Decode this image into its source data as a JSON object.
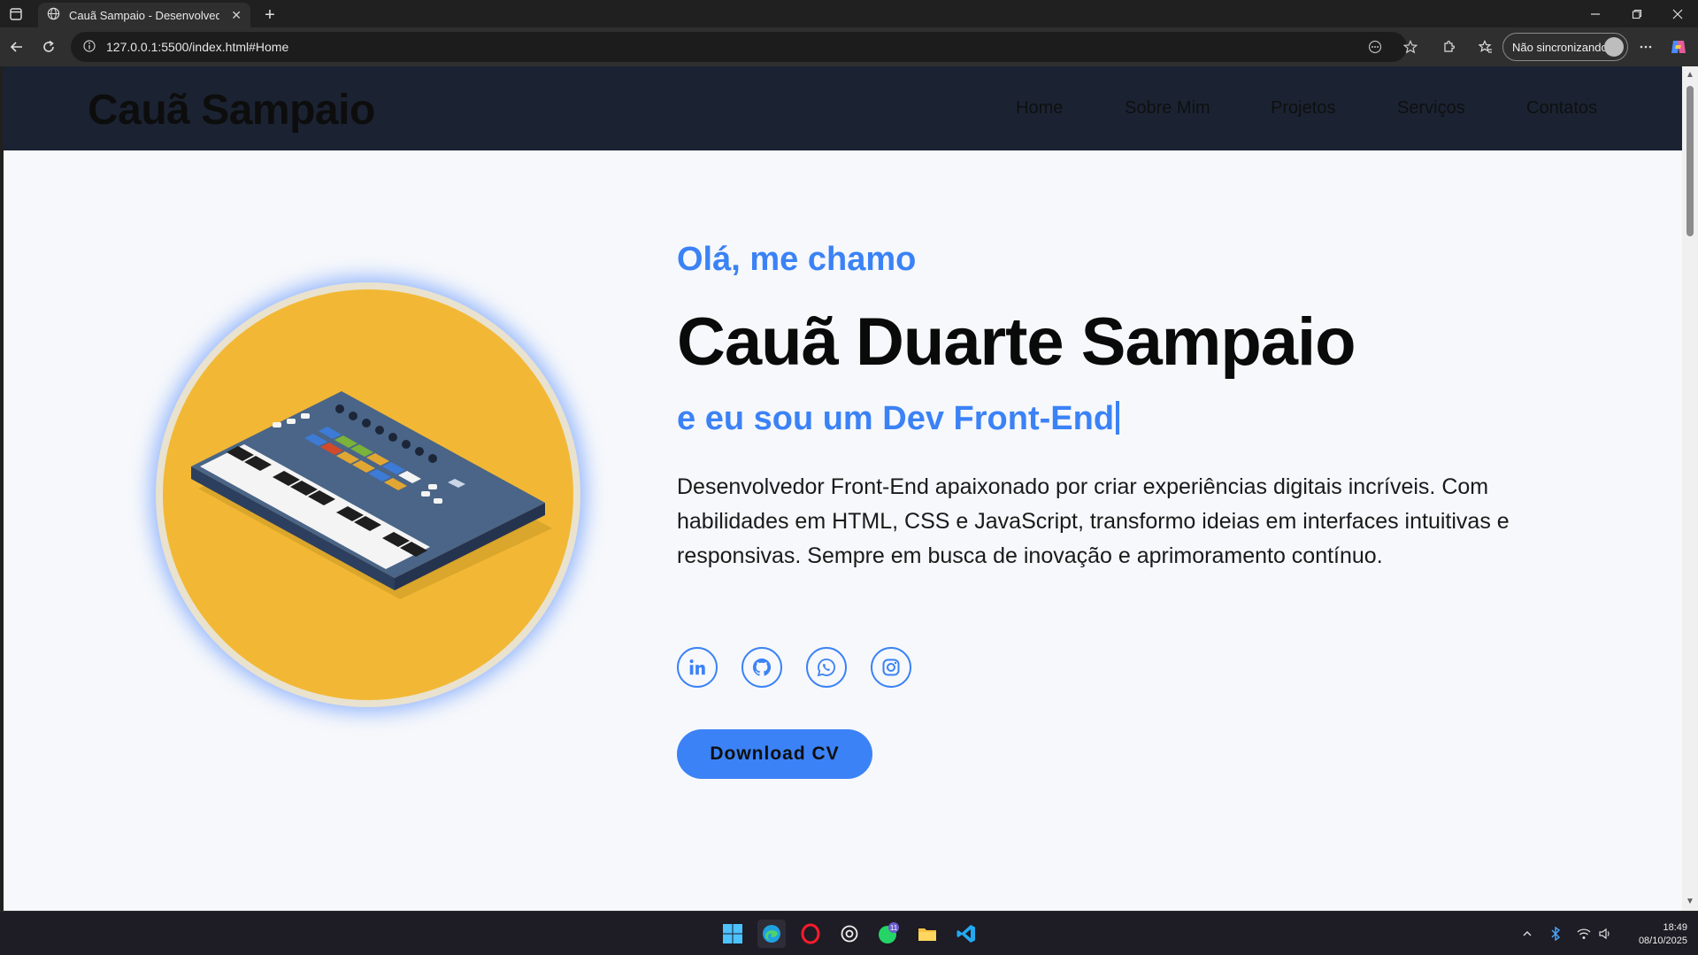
{
  "browser": {
    "tab_title": "Cauã Sampaio - Desenvolvedor F",
    "url": "127.0.0.1:5500/index.html#Home",
    "profile_label": "Não sincronizando"
  },
  "site": {
    "logo": "Cauã Sampaio",
    "nav": [
      "Home",
      "Sobre Mim",
      "Projetos",
      "Serviços",
      "Contatos"
    ],
    "hero": {
      "greeting": "Olá, me chamo",
      "name": "Cauã Duarte Sampaio",
      "role": "e eu sou um Dev Front-End",
      "description": "Desenvolvedor Front-End apaixonado por criar experiências digitais incríveis. Com habilidades em HTML, CSS e JavaScript, transformo ideias em interfaces intuitivas e responsivas. Sempre em busca de inovação e aprimoramento contínuo.",
      "cv_button": "Download CV"
    },
    "social_icons": [
      "linkedin-icon",
      "github-icon",
      "whatsapp-icon",
      "instagram-icon"
    ]
  },
  "taskbar": {
    "whatsapp_badge": "11",
    "time": "18:49",
    "date": "08/10/2025"
  },
  "colors": {
    "accent": "#3b82f6",
    "header_bg": "#1b2333",
    "avatar_bg": "#f2b835",
    "page_bg": "#f6f8fb"
  }
}
